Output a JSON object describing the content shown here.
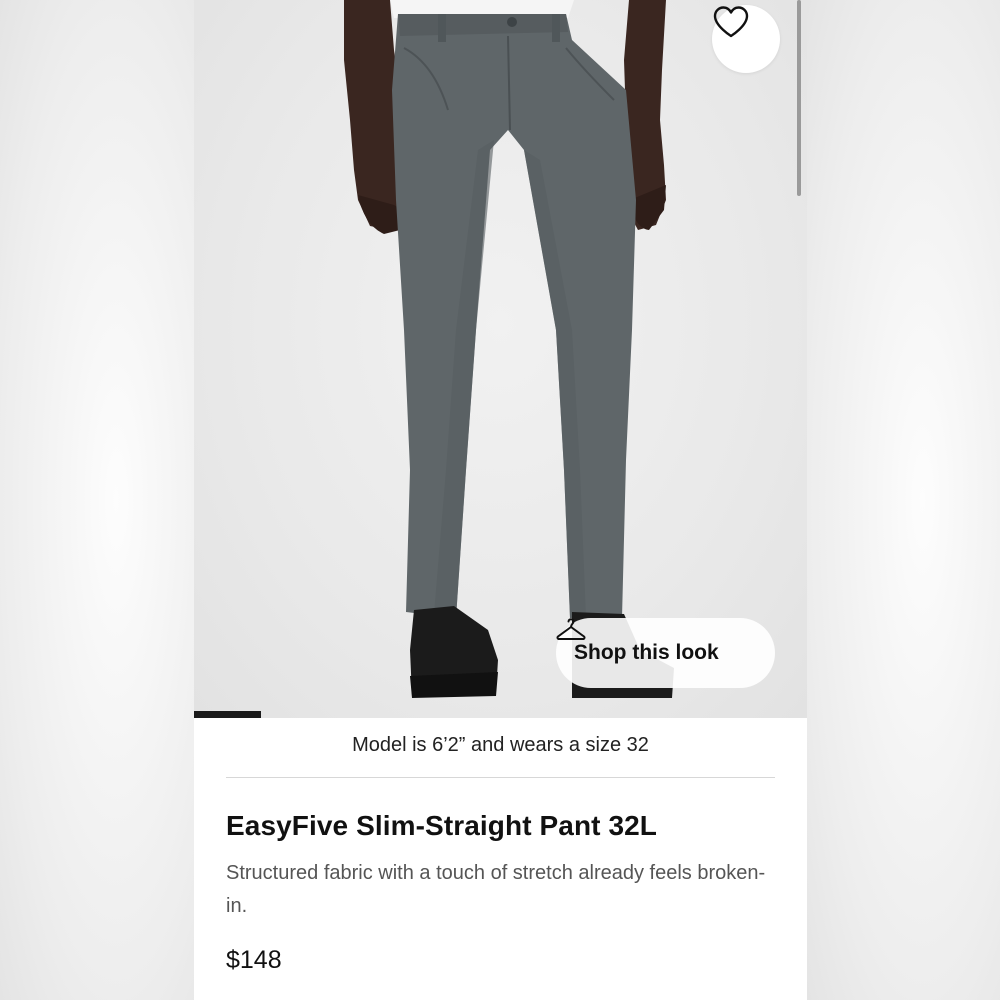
{
  "product": {
    "title": "EasyFive Slim-Straight Pant 32L",
    "description": "Structured fabric with a touch of stretch already feels broken-in.",
    "price": "$148"
  },
  "image": {
    "model_note": "Model is 6’2” and wears a size 32",
    "gallery_progress": 0.11
  },
  "actions": {
    "shop_this_look_label": "Shop this look",
    "shop_this_look_icon": "hanger-icon",
    "favorite_icon": "heart-outline-icon"
  },
  "colors": {
    "pant": "#5f6669",
    "accent": "#1a1a1a"
  }
}
